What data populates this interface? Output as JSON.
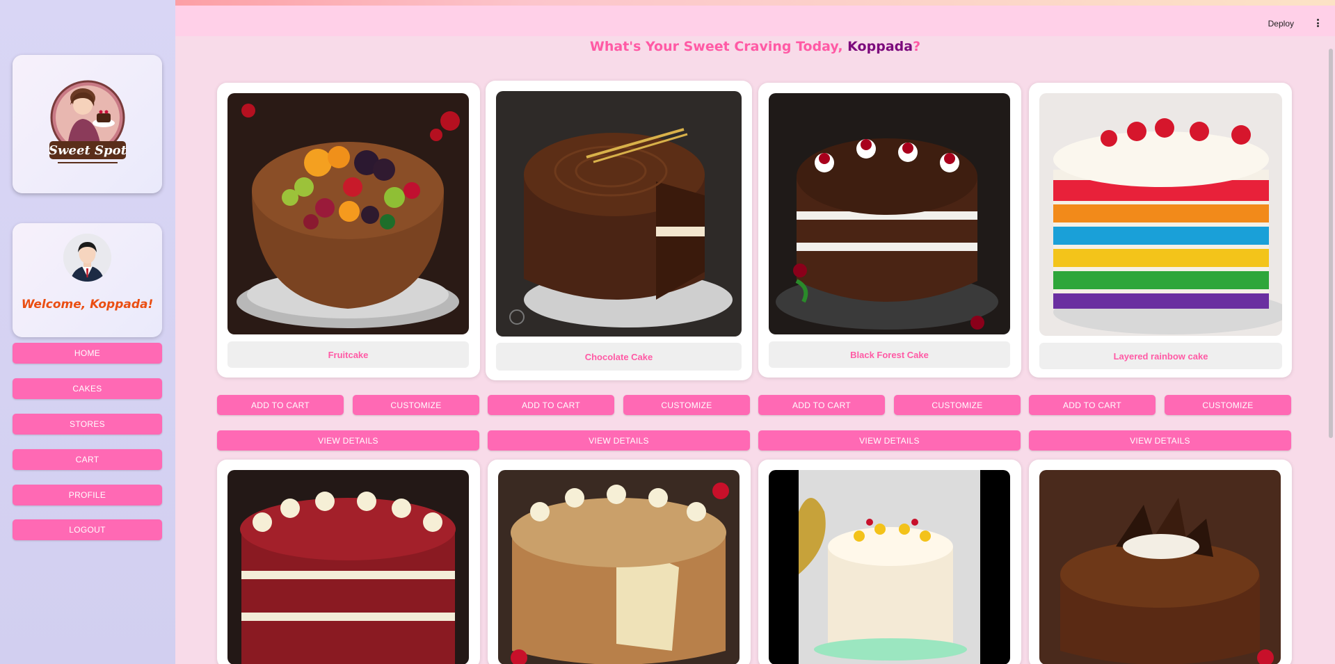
{
  "header": {
    "deploy_label": "Deploy",
    "menu_icon": "kebab-menu-icon"
  },
  "sidebar": {
    "brand": "Sweet Spot",
    "welcome": "Welcome, Koppada!",
    "nav": [
      {
        "label": "HOME"
      },
      {
        "label": "CAKES"
      },
      {
        "label": "STORES"
      },
      {
        "label": "CART"
      },
      {
        "label": "PROFILE"
      },
      {
        "label": "LOGOUT"
      }
    ]
  },
  "main": {
    "greeting_prefix": "What's Your Sweet Craving Today, ",
    "greeting_name": "Koppada",
    "greeting_suffix": "?",
    "add_to_cart_label": "ADD TO CART",
    "customize_label": "CUSTOMIZE",
    "view_details_label": "VIEW DETAILS",
    "cakes": [
      {
        "name": "Fruitcake"
      },
      {
        "name": "Chocolate Cake"
      },
      {
        "name": "Black Forest Cake"
      },
      {
        "name": "Layered rainbow cake"
      },
      {
        "name": ""
      },
      {
        "name": ""
      },
      {
        "name": ""
      },
      {
        "name": ""
      }
    ]
  },
  "colors": {
    "accent_pink": "#ff69b4",
    "title_pink": "#ff5aa5",
    "name_purple": "#7c0a7c",
    "welcome_orange": "#ea4e12",
    "sidebar_bg": "#d9d6f5",
    "main_bg": "#f8dbe9"
  }
}
